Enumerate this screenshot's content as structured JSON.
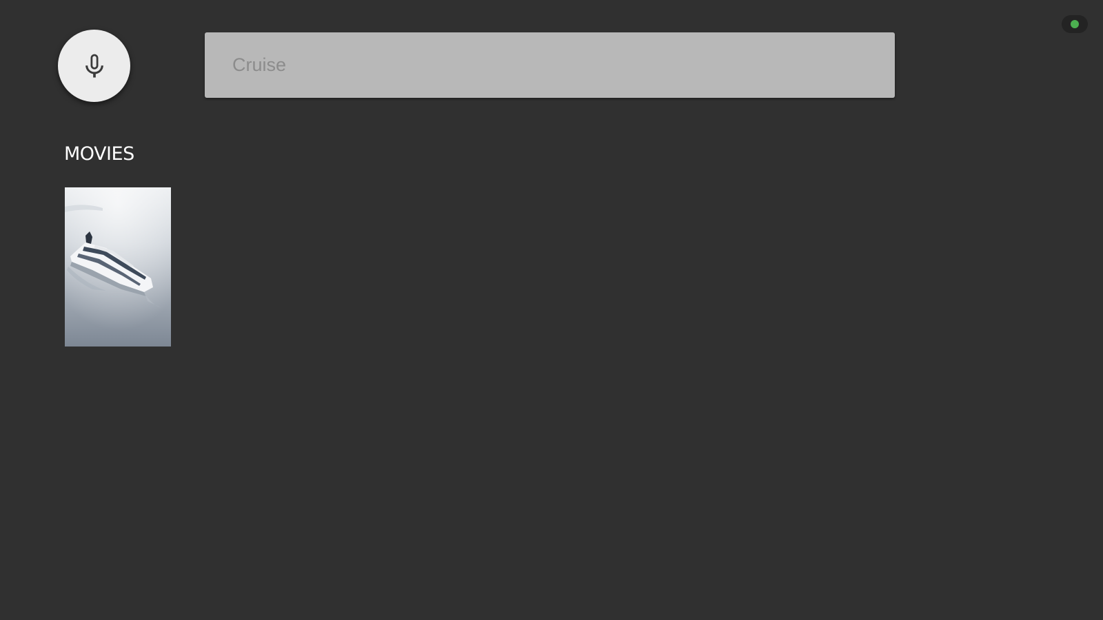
{
  "search": {
    "query": "Cruise",
    "mic_icon": "microphone-icon"
  },
  "results": {
    "section_title": "MOVIES",
    "movies": [
      {
        "thumbnail": "cruise-ship-poster"
      }
    ]
  },
  "status": {
    "indicator_color": "#4caf50"
  },
  "colors": {
    "background": "#303030",
    "search_box": "#b8b8b8",
    "mic_button": "#ececec"
  }
}
